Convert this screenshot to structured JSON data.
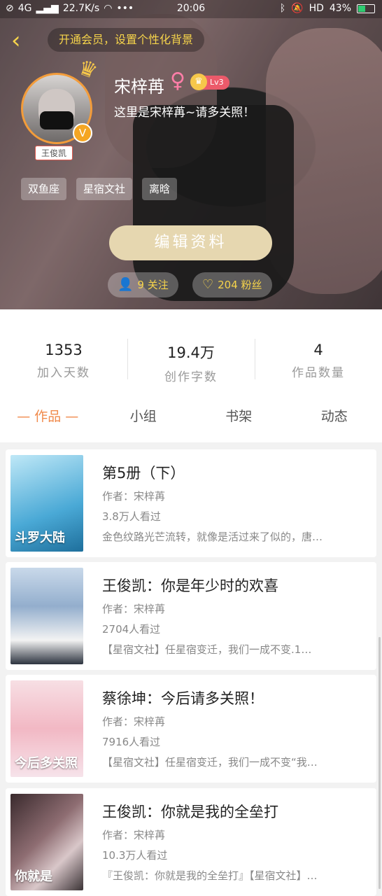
{
  "status_bar": {
    "network": "4G",
    "speed": "22.7K/s",
    "dots": "•••",
    "time": "20:06",
    "battery": "43%",
    "hd": "HD"
  },
  "header": {
    "vip_text": "开通会员，设置个性化背景"
  },
  "profile": {
    "avatar_label": "王俊凯",
    "name": "宋梓苒",
    "gender_symbol": "♀",
    "level": "Lv3",
    "bio": "这里是宋梓苒~请多关照！",
    "tags": [
      "双鱼座",
      "星宿文社",
      "离晗"
    ],
    "edit_button": "编辑资料",
    "following": "9 关注",
    "followers": "204 粉丝"
  },
  "stats": [
    {
      "value": "1353",
      "label": "加入天数"
    },
    {
      "value": "19.4万",
      "label": "创作字数"
    },
    {
      "value": "4",
      "label": "作品数量"
    }
  ],
  "tabs": [
    "— 作品 —",
    "小组",
    "书架",
    "动态"
  ],
  "works": [
    {
      "title": "第5册（下）",
      "author": "作者：宋梓苒",
      "views": "3.8万人看过",
      "desc": "金色纹路光芒流转，就像是活过来了似的，唐…",
      "cover_text": "斗罗大陆"
    },
    {
      "title": "王俊凯：你是年少时的欢喜",
      "author": "作者：宋梓苒",
      "views": "2704人看过",
      "desc": "【星宿文社】任星宿变迁，我们一成不变.1…",
      "cover_text": ""
    },
    {
      "title": "蔡徐坤：今后请多关照！",
      "author": "作者：宋梓苒",
      "views": "7916人看过",
      "desc": "【星宿文社】任星宿变迁，我们一成不变“我…",
      "cover_text": "今后多关照"
    },
    {
      "title": "王俊凯：你就是我的全垒打",
      "author": "作者：宋梓苒",
      "views": "10.3万人看过",
      "desc": "『王俊凯：你就是我的全垒打』【星宿文社】…",
      "cover_text": "你就是"
    }
  ]
}
